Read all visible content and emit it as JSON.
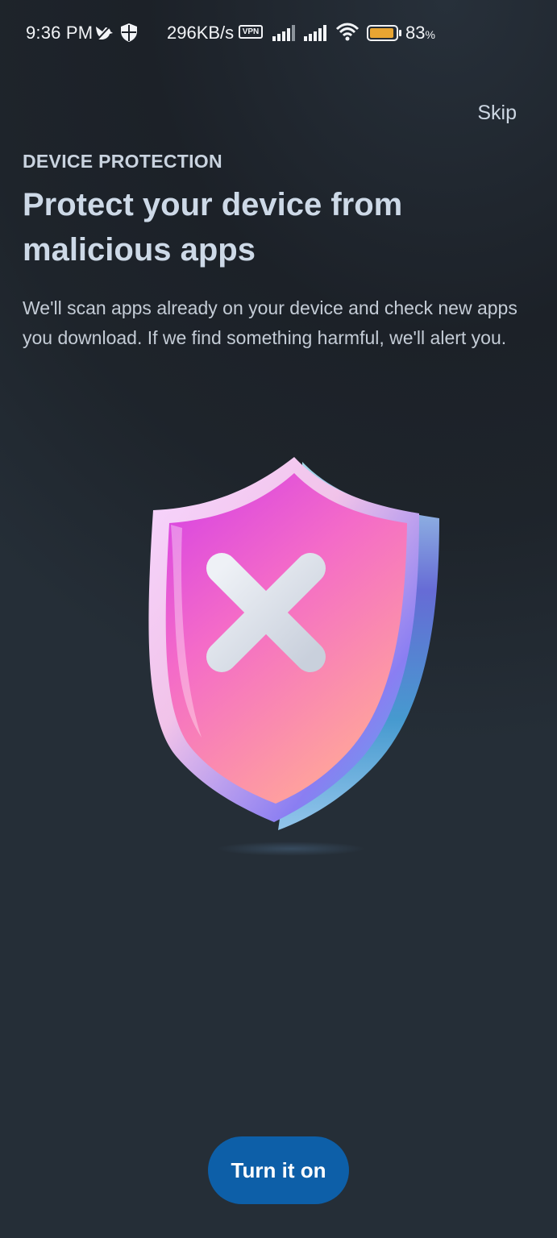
{
  "status_bar": {
    "time": "9:36 PM",
    "network_speed": "296KB/s",
    "vpn_label": "VPN",
    "battery_percent": "83",
    "battery_unit": "%",
    "icons": [
      "bird-icon",
      "shield-icon",
      "vpn-icon",
      "signal-icon",
      "signal-icon",
      "wifi-icon",
      "battery-icon"
    ],
    "battery_color": "#e8a532"
  },
  "header": {
    "skip_label": "Skip"
  },
  "content": {
    "eyebrow": "DEVICE PROTECTION",
    "title": "Protect your device from malicious apps",
    "description": "We'll scan apps already on your device and check new apps you download. If we find something harmful, we'll alert you.",
    "illustration": "shield-with-x-icon"
  },
  "footer": {
    "primary_button": "Turn it on",
    "primary_color": "#0d5fa8"
  }
}
